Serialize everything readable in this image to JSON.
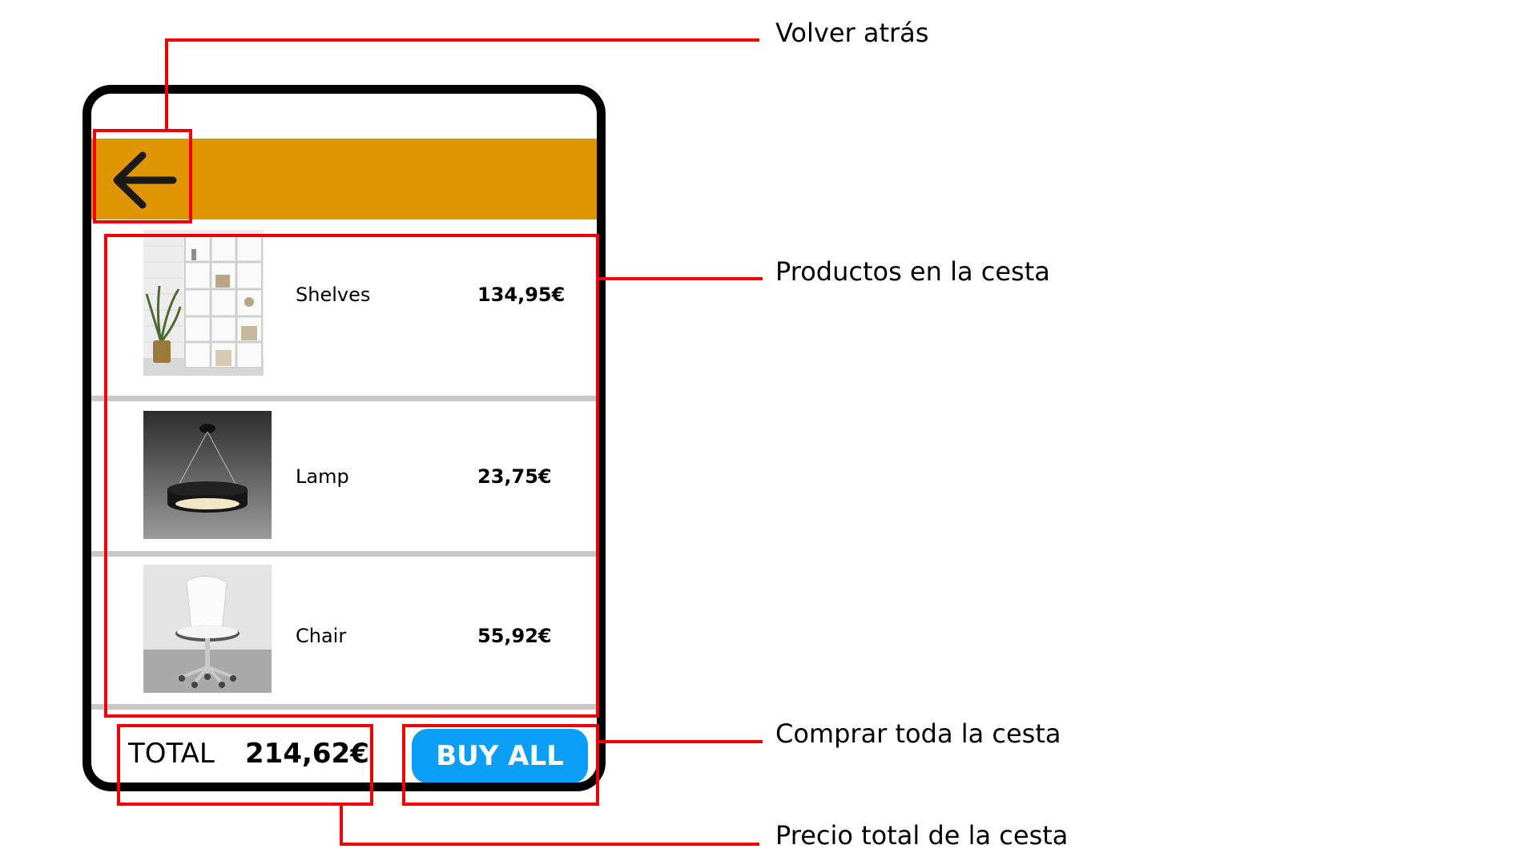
{
  "cart": {
    "back_icon": "arrow-left-icon",
    "header_color": "#df9600",
    "items": [
      {
        "name": "Shelves",
        "price": "134,95€",
        "image": "white-bookshelf-with-plant"
      },
      {
        "name": "Lamp",
        "price": "23,75€",
        "image": "black-ring-pendant-lamp"
      },
      {
        "name": "Chair",
        "price": "55,92€",
        "image": "white-office-chair"
      }
    ],
    "total_label": "TOTAL",
    "total_value": "214,62€",
    "buy_label": "BUY ALL",
    "buy_color": "#0a9ef7"
  },
  "annotations": {
    "back": "Volver atrás",
    "products": "Productos en la cesta",
    "buy_all": "Comprar toda la cesta",
    "total": "Precio total de la cesta",
    "color": "#f00000"
  }
}
